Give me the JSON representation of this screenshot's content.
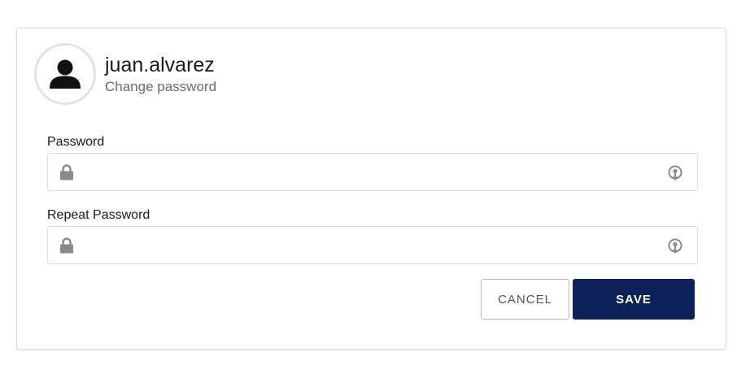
{
  "user": {
    "username": "juan.alvarez",
    "subtitle": "Change password",
    "avatar_icon": "user-icon"
  },
  "form": {
    "password": {
      "label": "Password",
      "value": "",
      "placeholder": "",
      "left_icon": "lock-icon",
      "right_icon": "eye-reveal-icon"
    },
    "repeat_password": {
      "label": "Repeat Password",
      "value": "",
      "placeholder": "",
      "left_icon": "lock-icon",
      "right_icon": "eye-reveal-icon"
    }
  },
  "actions": {
    "cancel_label": "CANCEL",
    "save_label": "SAVE"
  },
  "colors": {
    "primary": "#0b2158",
    "border": "#dcdcdc",
    "muted_text": "#6b6b6b",
    "icon_gray": "#8a8a8a"
  }
}
